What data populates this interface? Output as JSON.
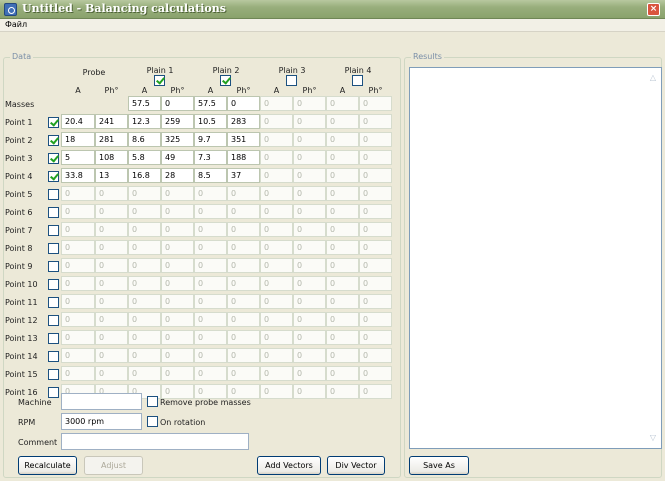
{
  "window": {
    "title": "Untitled - Balancing calculations",
    "close_label": "×"
  },
  "menu": {
    "file": "Файл"
  },
  "data_group": {
    "title": "Data"
  },
  "results_group": {
    "title": "Results"
  },
  "planes": {
    "probe": "Probe",
    "plain1": "Plain 1",
    "plain2": "Plain 2",
    "plain3": "Plain 3",
    "plain4": "Plain 4"
  },
  "plane_checked": [
    true,
    true,
    false,
    false
  ],
  "sub_a": "A",
  "sub_ph": "Ph°",
  "masses": {
    "label": "Masses",
    "values": [
      "57.5",
      "0",
      "57.5",
      "0",
      "0",
      "0",
      "0",
      "0"
    ]
  },
  "points": [
    {
      "label": "Point 1",
      "checked": true,
      "values": [
        "20.4",
        "241",
        "12.3",
        "259",
        "10.5",
        "283",
        "0",
        "0",
        "0",
        "0"
      ]
    },
    {
      "label": "Point 2",
      "checked": true,
      "values": [
        "18",
        "281",
        "8.6",
        "325",
        "9.7",
        "351",
        "0",
        "0",
        "0",
        "0"
      ]
    },
    {
      "label": "Point 3",
      "checked": true,
      "values": [
        "5",
        "108",
        "5.8",
        "49",
        "7.3",
        "188",
        "0",
        "0",
        "0",
        "0"
      ]
    },
    {
      "label": "Point 4",
      "checked": true,
      "values": [
        "33.8",
        "13",
        "16.8",
        "28",
        "8.5",
        "37",
        "0",
        "0",
        "0",
        "0"
      ]
    },
    {
      "label": "Point 5",
      "checked": false,
      "values": [
        "0",
        "0",
        "0",
        "0",
        "0",
        "0",
        "0",
        "0",
        "0",
        "0"
      ]
    },
    {
      "label": "Point 6",
      "checked": false,
      "values": [
        "0",
        "0",
        "0",
        "0",
        "0",
        "0",
        "0",
        "0",
        "0",
        "0"
      ]
    },
    {
      "label": "Point 7",
      "checked": false,
      "values": [
        "0",
        "0",
        "0",
        "0",
        "0",
        "0",
        "0",
        "0",
        "0",
        "0"
      ]
    },
    {
      "label": "Point 8",
      "checked": false,
      "values": [
        "0",
        "0",
        "0",
        "0",
        "0",
        "0",
        "0",
        "0",
        "0",
        "0"
      ]
    },
    {
      "label": "Point 9",
      "checked": false,
      "values": [
        "0",
        "0",
        "0",
        "0",
        "0",
        "0",
        "0",
        "0",
        "0",
        "0"
      ]
    },
    {
      "label": "Point 10",
      "checked": false,
      "values": [
        "0",
        "0",
        "0",
        "0",
        "0",
        "0",
        "0",
        "0",
        "0",
        "0"
      ]
    },
    {
      "label": "Point 11",
      "checked": false,
      "values": [
        "0",
        "0",
        "0",
        "0",
        "0",
        "0",
        "0",
        "0",
        "0",
        "0"
      ]
    },
    {
      "label": "Point 12",
      "checked": false,
      "values": [
        "0",
        "0",
        "0",
        "0",
        "0",
        "0",
        "0",
        "0",
        "0",
        "0"
      ]
    },
    {
      "label": "Point 13",
      "checked": false,
      "values": [
        "0",
        "0",
        "0",
        "0",
        "0",
        "0",
        "0",
        "0",
        "0",
        "0"
      ]
    },
    {
      "label": "Point 14",
      "checked": false,
      "values": [
        "0",
        "0",
        "0",
        "0",
        "0",
        "0",
        "0",
        "0",
        "0",
        "0"
      ]
    },
    {
      "label": "Point 15",
      "checked": false,
      "values": [
        "0",
        "0",
        "0",
        "0",
        "0",
        "0",
        "0",
        "0",
        "0",
        "0"
      ]
    },
    {
      "label": "Point 16",
      "checked": false,
      "values": [
        "0",
        "0",
        "0",
        "0",
        "0",
        "0",
        "0",
        "0",
        "0",
        "0"
      ]
    }
  ],
  "form": {
    "machine_label": "Machine",
    "machine_value": "",
    "remove_probe_label": "Remove probe masses",
    "rpm_label": "RPM",
    "rpm_value": "3000 rpm",
    "on_rotation_label": "On rotation",
    "comment_label": "Comment",
    "comment_value": ""
  },
  "buttons": {
    "recalculate": "Recalculate",
    "adjust": "Adjust",
    "add_vectors": "Add Vectors",
    "div_vector": "Div Vector",
    "save_as": "Save As"
  },
  "colors": {
    "title_bar": "#98ae7c",
    "check": "#21a121",
    "border_blue": "#1c5180"
  }
}
